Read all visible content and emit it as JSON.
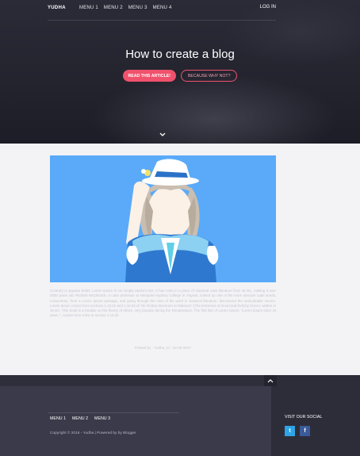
{
  "header": {
    "brand": "YUDHA",
    "menu": [
      "MENU 1",
      "MENU 2",
      "MENU 3",
      "MENU 4"
    ],
    "login": "LOG IN"
  },
  "hero": {
    "title": "How to create a blog",
    "primary_button": "READ THIS ARTICLE!",
    "secondary_button": "BECAUSE WHY NOT?",
    "chevron_icon": "chevron-down-icon"
  },
  "post": {
    "image_alt": "anime character illustration",
    "body": "Contrary to popular belief, Lorem Ipsum is not simply random text. It has roots in a piece of classical Latin literature from 45 BC, making it over 2000 years old. Richard McClintock, a Latin professor at Hampden-Sydney College in Virginia, looked up one of the more obscure Latin words, consectetur, from a Lorem Ipsum passage, and going through the cites of the word in classical literature, discovered the undoubtable source. Lorem Ipsum comes from sections 1.10.32 and 1.10.33 of \"de Finibus Bonorum et Malorum\" (The Extremes of Good and Evil) by Cicero, written in 45 BC. This book is a treatise on the theory of ethics, very popular during the Renaissance. The first line of Lorem Ipsum, \"Lorem ipsum dolor sit amet..\", comes from a line in section 1.10.32.",
    "meta": "Posted by : Yudha_Al : 19-05-2017"
  },
  "footer": {
    "menu": [
      "MENU 1",
      "MENU 2",
      "MENU 3"
    ],
    "copyright": "Copyright © 2016 - Yudha | Powered by by Blogger",
    "social_title": "VISIT OUR SOCIAL",
    "social": [
      {
        "name": "twitter-icon",
        "glyph": "t",
        "color": "#2ea3e6"
      },
      {
        "name": "facebook-icon",
        "glyph": "f",
        "color": "#3b5a9a"
      }
    ],
    "up_icon": "chevron-up-icon"
  },
  "colors": {
    "accent": "#f0516c",
    "hero_bg": "#24242f",
    "image_bg": "#5aaaf9",
    "footer_bg": "#3a3a4a"
  }
}
